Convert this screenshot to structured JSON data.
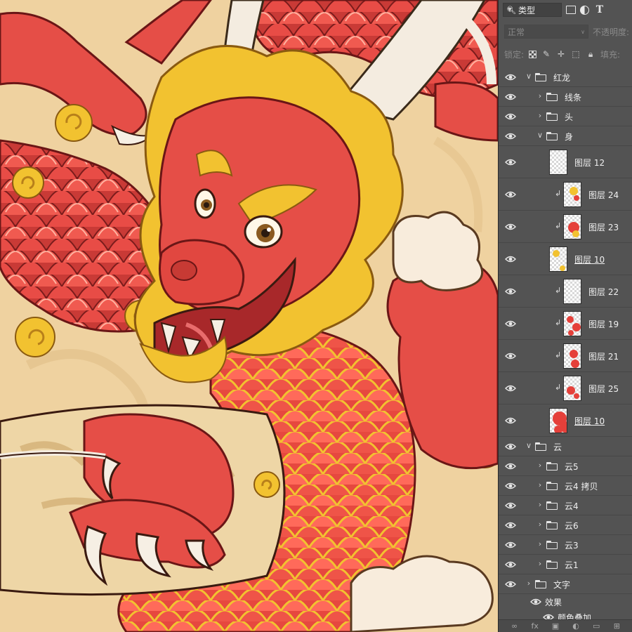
{
  "toolbar": {
    "filter_kind": "类型",
    "blend_mode": "正常",
    "opacity_label": "不透明度:",
    "lock_label": "锁定:",
    "fill_label": "填充:",
    "filter_icon_text": "T"
  },
  "layers": [
    {
      "name": "红龙",
      "kind": "group",
      "expanded": true
    },
    {
      "name": "线条",
      "kind": "group",
      "expanded": false
    },
    {
      "name": "头",
      "kind": "group",
      "expanded": false
    },
    {
      "name": "身",
      "kind": "group",
      "expanded": true
    },
    {
      "name": "图层 12",
      "kind": "layer"
    },
    {
      "name": "图层 24",
      "kind": "layer",
      "clipped": true
    },
    {
      "name": "图层 23",
      "kind": "layer",
      "clipped": true
    },
    {
      "name": "图层 10",
      "kind": "layer"
    },
    {
      "name": "图层 22",
      "kind": "layer",
      "clipped": true
    },
    {
      "name": "图层 19",
      "kind": "layer",
      "clipped": true
    },
    {
      "name": "图层 21",
      "kind": "layer",
      "clipped": true
    },
    {
      "name": "图层 25",
      "kind": "layer",
      "clipped": true
    },
    {
      "name": "图层 10",
      "kind": "layer"
    },
    {
      "name": "云",
      "kind": "group",
      "expanded": true
    },
    {
      "name": "云5",
      "kind": "group",
      "expanded": false
    },
    {
      "name": "云4 拷贝",
      "kind": "group",
      "expanded": false
    },
    {
      "name": "云4",
      "kind": "group",
      "expanded": false
    },
    {
      "name": "云6",
      "kind": "group",
      "expanded": false
    },
    {
      "name": "云3",
      "kind": "group",
      "expanded": false
    },
    {
      "name": "云1",
      "kind": "group",
      "expanded": false
    },
    {
      "name": "文字",
      "kind": "group",
      "expanded": false
    },
    {
      "name": "效果",
      "kind": "effects"
    },
    {
      "name": "颜色叠加",
      "kind": "effect"
    }
  ],
  "colors": {
    "dragon_red": "#e8504a",
    "dragon_dark": "#b83030",
    "gold": "#f2c230",
    "horn": "#f4ece0",
    "background": "#f0d6a4",
    "panel": "#535353"
  },
  "icons": [
    "search-icon",
    "image-filter-icon",
    "adjustment-filter-icon",
    "type-filter-icon",
    "eye-icon",
    "folder-icon",
    "link-icon",
    "fx-icon",
    "mask-icon",
    "new-group-icon",
    "new-layer-icon"
  ]
}
